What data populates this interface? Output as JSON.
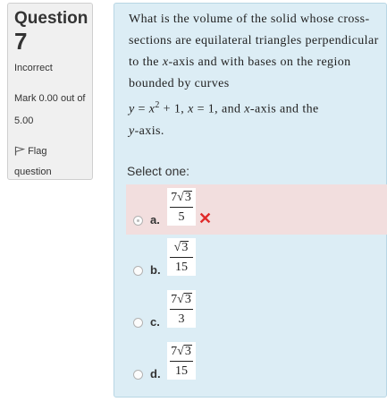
{
  "info": {
    "title": "Question",
    "number": "7",
    "state": "Incorrect",
    "grade": "Mark 0.00 out of 5.00",
    "flag_label": "Flag question"
  },
  "question": {
    "p1": "What is the volume of the solid whose cross-sections are equilateral triangles perpendicular to the",
    "p1_var": "x",
    "p1_end": "-axis and with bases on the region bounded by curves",
    "eq_y": "y",
    "eq_mid": " = ",
    "eq_x": "x",
    "eq_exp": "2",
    "eq_plus": " + 1, ",
    "eq_x2": "x",
    "eq_eq1": " = 1,  and ",
    "eq_x3": "x",
    "eq_rest": "-axis and the",
    "y_axis_var": "y",
    "y_axis_end": "-axis."
  },
  "prompt": "Select one:",
  "options": [
    {
      "letter": "a.",
      "coef": "7",
      "radicand": "3",
      "den": "5",
      "selected": true,
      "feedback_icon": "cross-icon",
      "feedback_mark": "✕"
    },
    {
      "letter": "b.",
      "coef": "",
      "radicand": "3",
      "den": "15",
      "selected": false
    },
    {
      "letter": "c.",
      "coef": "7",
      "radicand": "3",
      "den": "3",
      "selected": false
    },
    {
      "letter": "d.",
      "coef": "7",
      "radicand": "3",
      "den": "15",
      "selected": false
    }
  ],
  "colors": {
    "content_bg": "#dcedf5",
    "incorrect_bg": "#f2dede",
    "cross": "#e02a2a"
  }
}
